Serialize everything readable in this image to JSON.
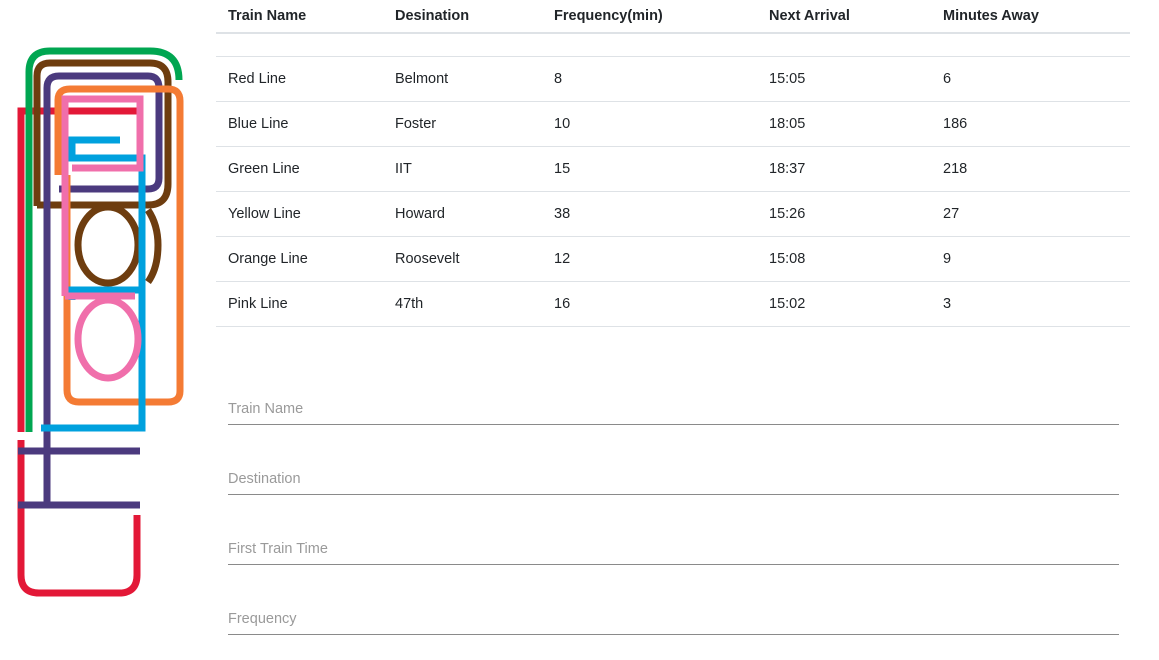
{
  "schedule": {
    "headers": [
      "Train Name",
      "Desination",
      "Frequency(min)",
      "Next Arrival",
      "Minutes Away"
    ],
    "rows": [
      [
        "Red Line",
        "Belmont",
        "8",
        "15:05",
        "6"
      ],
      [
        "Blue Line",
        "Foster",
        "10",
        "18:05",
        "186"
      ],
      [
        "Green Line",
        "IIT",
        "15",
        "18:37",
        "218"
      ],
      [
        "Yellow Line",
        "Howard",
        "38",
        "15:26",
        "27"
      ],
      [
        "Orange Line",
        "Roosevelt",
        "12",
        "15:08",
        "9"
      ],
      [
        "Pink Line",
        "47th",
        "16",
        "15:02",
        "3"
      ]
    ]
  },
  "form": {
    "train_name_placeholder": "Train Name",
    "destination_placeholder": "Destination",
    "first_train_time_placeholder": "First Train Time",
    "frequency_placeholder": "Frequency"
  },
  "logo": {
    "icon": "cta-train-lines-logo",
    "colors": {
      "red": "#e31837",
      "green": "#00a651",
      "brown": "#6e3d0f",
      "purple": "#4b3a7e",
      "orange": "#f47b34",
      "pink": "#f06fab",
      "blue": "#00a1de"
    }
  }
}
